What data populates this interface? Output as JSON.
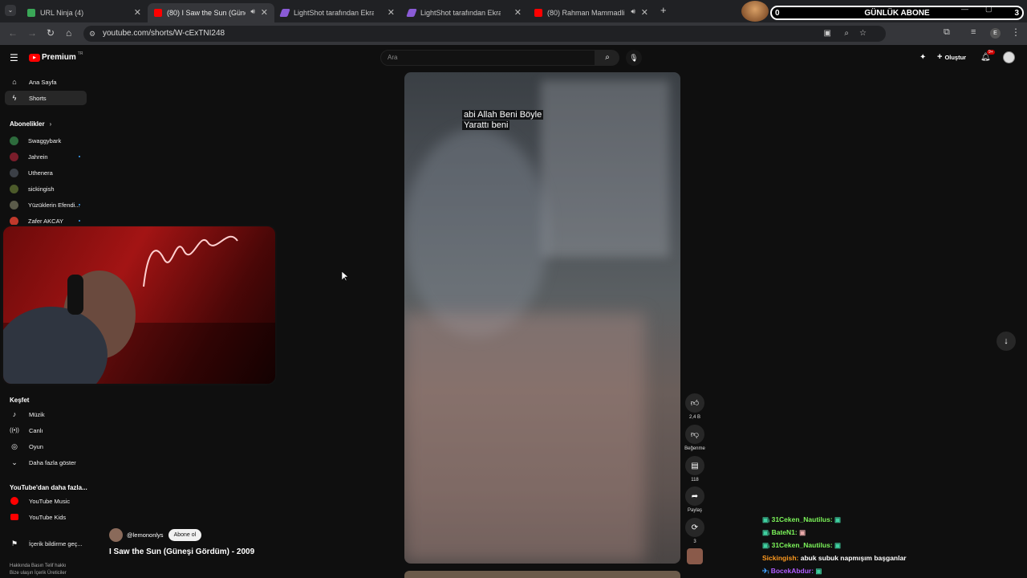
{
  "tabs": [
    {
      "title": "URL Ninja (4)",
      "color": "#3aa757"
    },
    {
      "title": "(80) I Saw the Sun (Güneşi Gördüm)",
      "color": "#ff0000",
      "active": true
    },
    {
      "title": "LightShot tarafından Ekran Görüntüsü",
      "color": "#8a5bd6"
    },
    {
      "title": "LightShot tarafından Ekran Görüntüsü",
      "color": "#8a5bd6"
    },
    {
      "title": "(80) Rahman Mammadli - Diwan",
      "color": "#ff0000"
    }
  ],
  "overlay": {
    "count_left": "0",
    "label": "GÜNLÜK ABONE",
    "count_right": "3"
  },
  "url": "youtube.com/shorts/W-cExTNI248",
  "yt": {
    "brand": "Premium",
    "region": "TR",
    "search_placeholder": "Ara",
    "create_label": "Oluştur",
    "notif_count": "9+"
  },
  "sidebar": {
    "home": "Ana Sayfa",
    "shorts": "Shorts",
    "subs_heading": "Abonelikler",
    "subs": [
      "Swaggybark",
      "Jahrein",
      "Uthenera",
      "sickingish",
      "Yüzüklerin Efendi...",
      "Zafer AKCAY"
    ],
    "explore_heading": "Keşfet",
    "explore": [
      "Müzik",
      "Canlı",
      "Oyun",
      "Daha fazla göster"
    ],
    "more_heading": "YouTube'dan daha fazla...",
    "more": [
      "YouTube Music",
      "YouTube Kids"
    ],
    "report": "İçerik bildirme geç...",
    "footer1": "Hakkında   Basın   Telif hakkı",
    "footer2": "Bize ulaşın   İçerik Üreticiler"
  },
  "video": {
    "caption_line1": "abi Allah Beni Böyle",
    "caption_line2": "Yarattı beni",
    "channel": "@lemononlys",
    "subscribe": "Abone ol",
    "title": "I Saw the Sun (Güneşi Gördüm) - 2009"
  },
  "actions": {
    "likes": "2,4 B",
    "dislike": "Beğenme",
    "comments": "118",
    "share": "Paylaş",
    "remix": "3"
  },
  "chat": [
    {
      "user": "31Ceken_Nautilus:",
      "color": "#7cf55a",
      "msg": ""
    },
    {
      "user": "BateN1:",
      "color": "#7cf55a",
      "msg": ""
    },
    {
      "user": "31Ceken_Nautilus:",
      "color": "#7cf55a",
      "msg": ""
    },
    {
      "user": "Sickingish:",
      "color": "#ff9a1f",
      "msg": "abuk subuk napmışım başganlar"
    },
    {
      "user": "BocekAbdur:",
      "color": "#b05cff",
      "msg": ""
    }
  ]
}
